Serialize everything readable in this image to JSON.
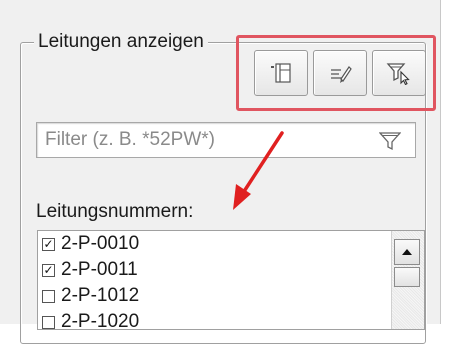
{
  "group": {
    "title": "Leitungen anzeigen"
  },
  "toolbar": {
    "buttons": [
      {
        "icon": "panel-layout-icon"
      },
      {
        "icon": "pen-edit-icon"
      },
      {
        "icon": "filter-cursor-icon"
      }
    ],
    "highlight_color": "#e05560"
  },
  "filter": {
    "placeholder": "Filter (z. B. *52PW*)",
    "value": "",
    "icon": "funnel-icon"
  },
  "list": {
    "label": "Leitungsnummern:",
    "items": [
      {
        "label": "2-P-0010",
        "checked": true
      },
      {
        "label": "2-P-0011",
        "checked": true
      },
      {
        "label": "2-P-1012",
        "checked": false
      },
      {
        "label": "2-P-1020",
        "checked": false
      }
    ]
  },
  "annotation": {
    "arrow_color": "#e02020"
  }
}
